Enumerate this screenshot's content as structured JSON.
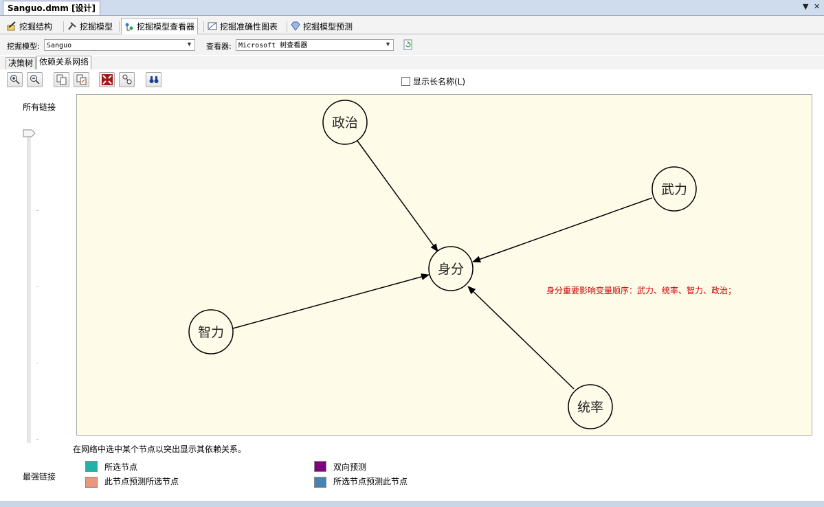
{
  "document": {
    "tab_title": "Sanguo.dmm [设计]"
  },
  "designer_tabs": [
    {
      "label": "挖掘结构",
      "icon": "structure-icon"
    },
    {
      "label": "挖掘模型",
      "icon": "model-icon"
    },
    {
      "label": "挖掘模型查看器",
      "icon": "viewer-icon"
    },
    {
      "label": "挖掘准确性图表",
      "icon": "accuracy-chart-icon"
    },
    {
      "label": "挖掘模型预测",
      "icon": "prediction-icon"
    }
  ],
  "selectors": {
    "model_label": "挖掘模型:",
    "model_value": "Sanguo",
    "viewer_label": "查看器:",
    "viewer_value": "Microsoft 树查看器"
  },
  "view_tabs": [
    "决策树",
    "依赖关系网络"
  ],
  "toolbar": {
    "show_long_names_label": "显示长名称(L)"
  },
  "slider": {
    "top_label": "所有链接",
    "bottom_label": "最强链接"
  },
  "network": {
    "nodes": {
      "center": "身分",
      "politics": "政治",
      "force": "武力",
      "intel": "智力",
      "command": "统率"
    },
    "annotation": "身分重要影响变量顺序：武力、统率、智力、政治；"
  },
  "hint": "在网络中选中某个节点以突出显示其依赖关系。",
  "legend": [
    {
      "label": "所选节点",
      "color": "#20b2aa"
    },
    {
      "label": "此节点预测所选节点",
      "color": "#e9967a"
    },
    {
      "label": "双向预测",
      "color": "#800080"
    },
    {
      "label": "所选节点预测此节点",
      "color": "#4682b4"
    }
  ],
  "colors": {
    "annotation": "#cc0000",
    "canvas": "#fefbe8"
  }
}
